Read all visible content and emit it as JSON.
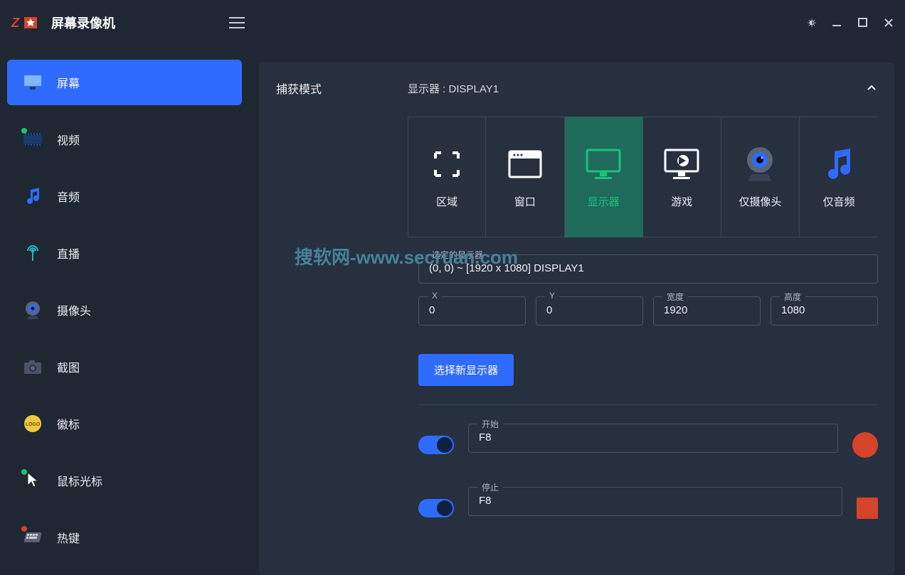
{
  "app": {
    "title": "屏幕录像机"
  },
  "sidebar": {
    "items": [
      {
        "label": "屏幕"
      },
      {
        "label": "视频"
      },
      {
        "label": "音频"
      },
      {
        "label": "直播"
      },
      {
        "label": "摄像头"
      },
      {
        "label": "截图"
      },
      {
        "label": "徽标"
      },
      {
        "label": "鼠标光标"
      },
      {
        "label": "热键"
      }
    ]
  },
  "capture": {
    "section_label": "捕获模式",
    "current_display": "显示器 : DISPLAY1",
    "modes": [
      {
        "label": "区域"
      },
      {
        "label": "窗口"
      },
      {
        "label": "显示器"
      },
      {
        "label": "游戏"
      },
      {
        "label": "仅摄像头"
      },
      {
        "label": "仅音频"
      }
    ],
    "selected_display": {
      "label": "选定的显示器",
      "value": "(0, 0) ~ [1920 x 1080]  DISPLAY1"
    },
    "coords": {
      "x_label": "X",
      "x": "0",
      "y_label": "Y",
      "y": "0",
      "w_label": "宽度",
      "w": "1920",
      "h_label": "高度",
      "h": "1080"
    },
    "select_new_button": "选择新显示器",
    "hotkeys": {
      "start": {
        "label": "开始",
        "value": "F8"
      },
      "stop": {
        "label": "停止",
        "value": "F8"
      }
    }
  },
  "watermark": "搜软网-www.secruan.com"
}
